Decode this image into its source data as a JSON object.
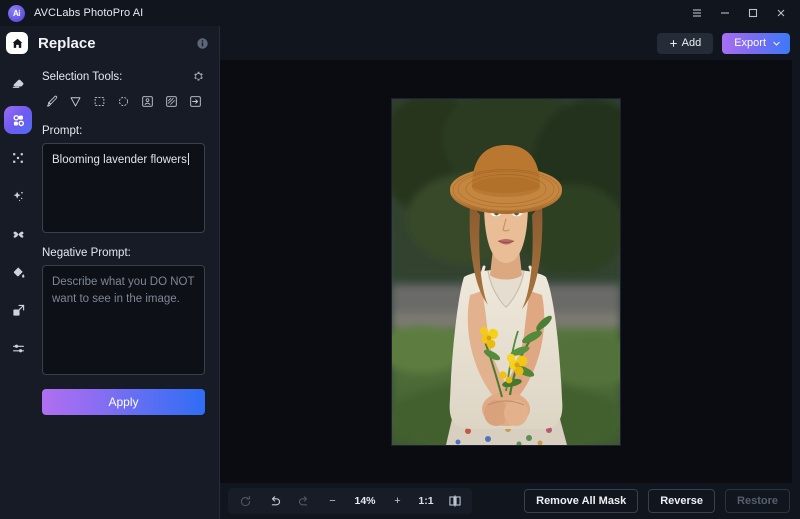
{
  "window": {
    "app_name": "AVCLabs PhotoPro AI",
    "logo_text": "Ai",
    "controls": [
      {
        "name": "menu-button",
        "icon": "hamburger-icon"
      },
      {
        "name": "minimize-button",
        "icon": "minimize-icon"
      },
      {
        "name": "maximize-button",
        "icon": "maximize-icon"
      },
      {
        "name": "close-button",
        "icon": "close-icon"
      }
    ]
  },
  "sidebar": {
    "page_title": "Replace",
    "home_icon": "home-icon",
    "info_icon": "info-icon",
    "rail_items": [
      {
        "name": "rail-item-erase",
        "icon": "eraser-icon",
        "active": false
      },
      {
        "name": "rail-item-replace",
        "icon": "replace-magic-icon",
        "active": true
      },
      {
        "name": "rail-item-expand",
        "icon": "expand-corners-icon",
        "active": false
      },
      {
        "name": "rail-item-enhance",
        "icon": "magic-wand-icon",
        "active": false
      },
      {
        "name": "rail-item-retouch",
        "icon": "butterfly-icon",
        "active": false
      },
      {
        "name": "rail-item-colorize",
        "icon": "paint-bucket-icon",
        "active": false
      },
      {
        "name": "rail-item-resize",
        "icon": "resize-icon",
        "active": false
      },
      {
        "name": "rail-item-adjust",
        "icon": "sliders-icon",
        "active": false
      }
    ],
    "selection_tools_label": "Selection Tools:",
    "settings_icon": "gear-icon",
    "tools": [
      {
        "name": "tool-brush",
        "icon": "brush-icon"
      },
      {
        "name": "tool-lasso",
        "icon": "cursor-lasso-icon"
      },
      {
        "name": "tool-rect-select",
        "icon": "rectangle-select-icon"
      },
      {
        "name": "tool-ellipse-select",
        "icon": "ellipse-select-icon"
      },
      {
        "name": "tool-subject-select",
        "icon": "subject-portrait-icon"
      },
      {
        "name": "tool-background-select",
        "icon": "background-hatch-icon"
      },
      {
        "name": "tool-import-mask",
        "icon": "import-arrow-icon"
      }
    ],
    "prompt_label": "Prompt:",
    "prompt_value": "Blooming lavender flowers",
    "negative_prompt_label": "Negative Prompt:",
    "negative_prompt_value": "",
    "negative_prompt_placeholder": "Describe what you DO NOT want to see in the image.",
    "apply_label": "Apply"
  },
  "topbar": {
    "add_label": "Add",
    "add_icon": "plus-icon",
    "export_label": "Export",
    "export_caret_icon": "chevron-down-icon"
  },
  "bottombar": {
    "reset_icon": "reset-circle-icon",
    "undo_icon": "undo-arrow-icon",
    "redo_icon": "redo-arrow-icon",
    "zoom_out_label": "−",
    "zoom_level": "14%",
    "zoom_in_label": "+",
    "fit_ratio_label": "1:1",
    "compare_icon": "split-compare-icon",
    "remove_all_mask_label": "Remove All Mask",
    "reverse_label": "Reverse",
    "restore_label": "Restore"
  },
  "canvas": {
    "image_alt": "Woman in straw hat holding yellow flowers in a green field",
    "background_color": "#0a0c11"
  }
}
